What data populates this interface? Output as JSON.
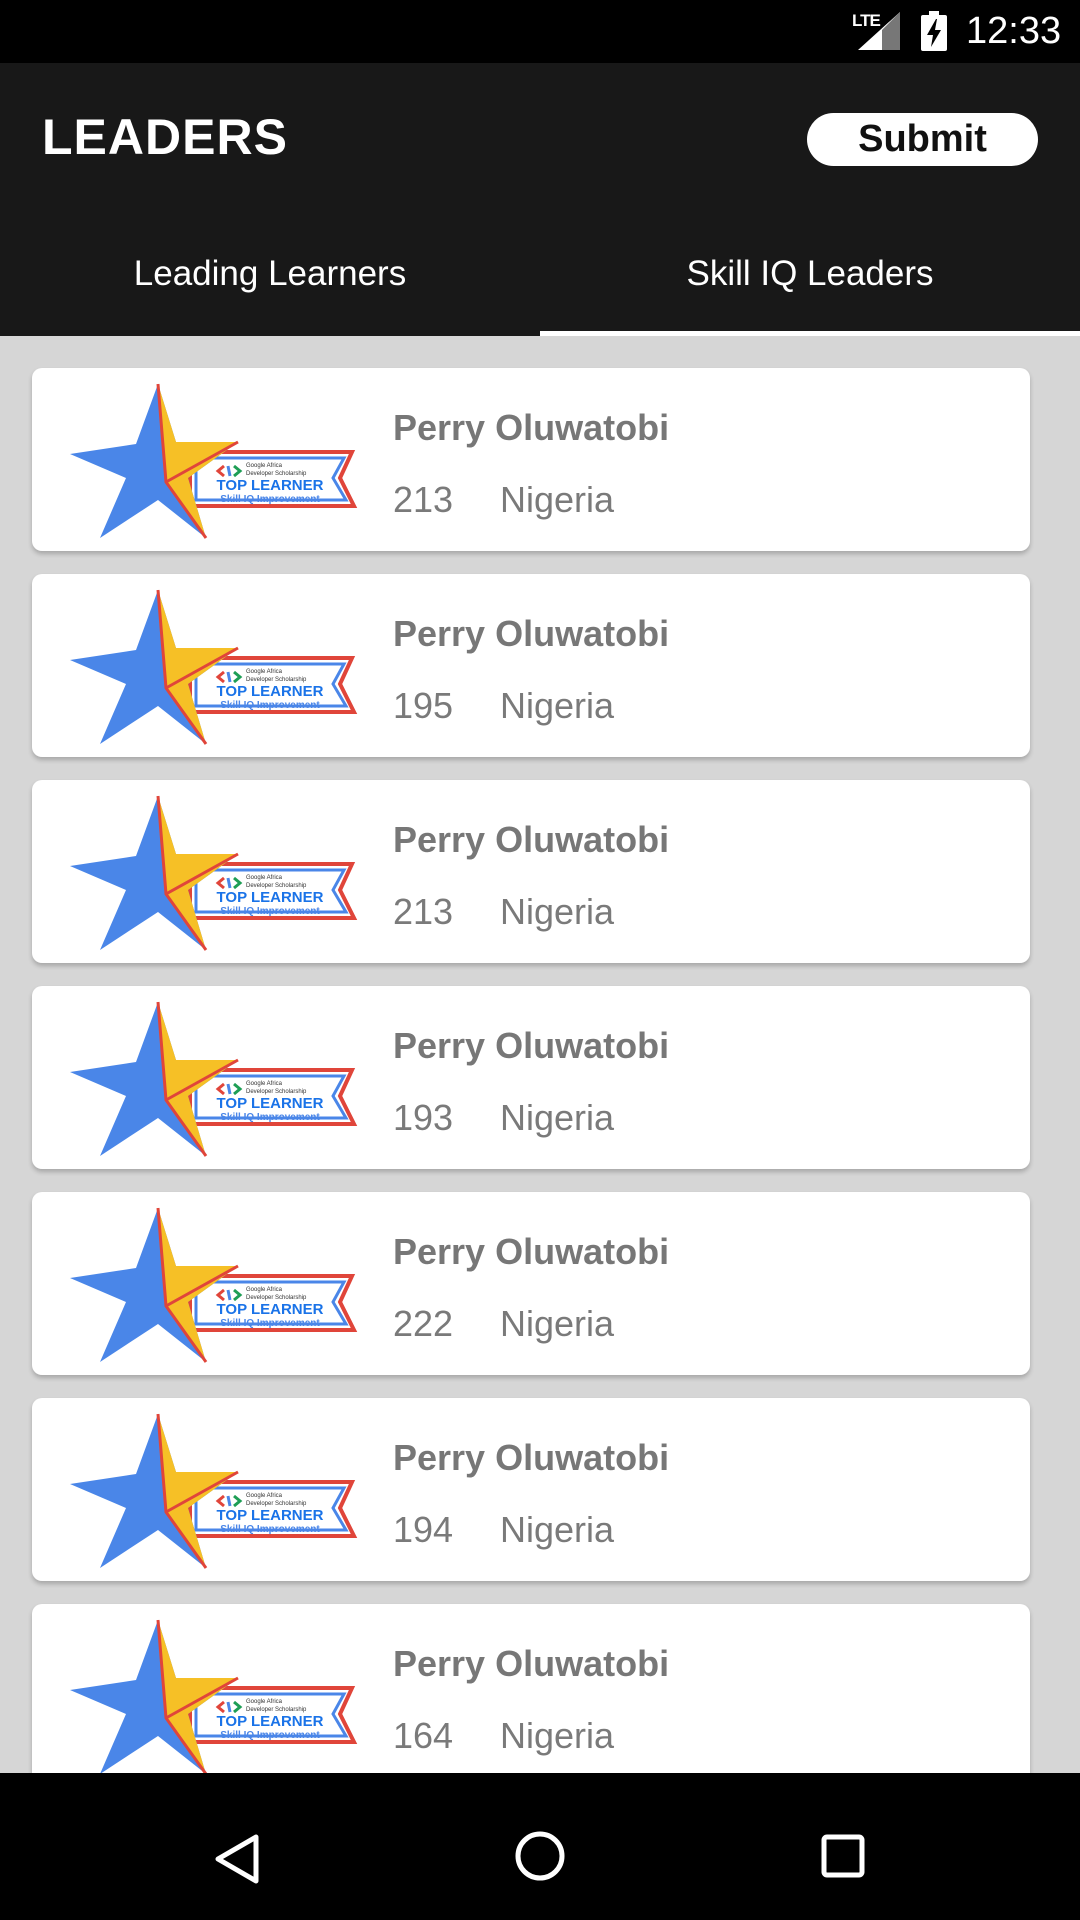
{
  "status_bar": {
    "network": "LTE",
    "time": "12:33",
    "icons": [
      "signal-icon",
      "battery-charging-icon"
    ]
  },
  "app_bar": {
    "title": "LEADERS",
    "submit_label": "Submit"
  },
  "tabs": [
    {
      "label": "Leading Learners",
      "selected": false
    },
    {
      "label": "Skill IQ Leaders",
      "selected": true
    }
  ],
  "badge": {
    "line1": "Google Africa",
    "line2": "Developer Scholarship",
    "line3": "TOP LEARNER",
    "line4": "Skill IQ Improvement"
  },
  "leaders": [
    {
      "name": "Perry Oluwatobi",
      "score": "213",
      "country": "Nigeria"
    },
    {
      "name": "Perry Oluwatobi",
      "score": "195",
      "country": "Nigeria"
    },
    {
      "name": "Perry Oluwatobi",
      "score": "213",
      "country": "Nigeria"
    },
    {
      "name": "Perry Oluwatobi",
      "score": "193",
      "country": "Nigeria"
    },
    {
      "name": "Perry Oluwatobi",
      "score": "222",
      "country": "Nigeria"
    },
    {
      "name": "Perry Oluwatobi",
      "score": "194",
      "country": "Nigeria"
    },
    {
      "name": "Perry Oluwatobi",
      "score": "164",
      "country": "Nigeria"
    }
  ],
  "nav_bar": {
    "icons": [
      "back-icon",
      "home-icon",
      "recents-icon"
    ]
  },
  "colors": {
    "app_bar": "#181818",
    "list_background": "#d6d6d6",
    "star_blue": "#4a86e8",
    "star_yellow": "#f6c026",
    "ribbon_red": "#e0453a"
  }
}
